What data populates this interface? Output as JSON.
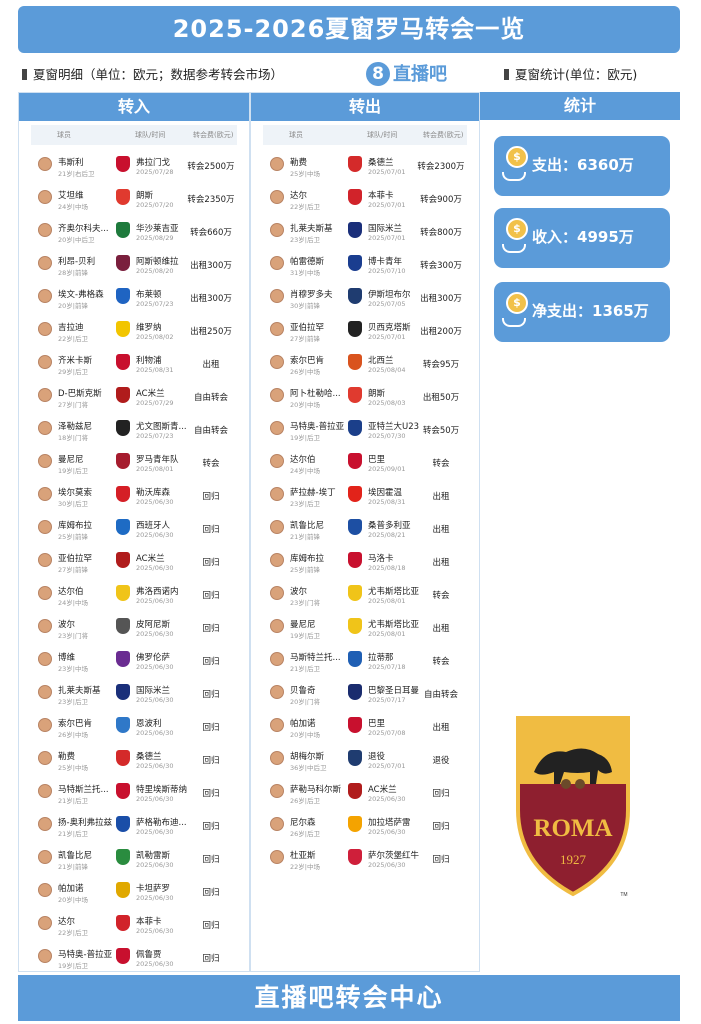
{
  "title": "2025-2026夏窗罗马转会一览",
  "subheads": {
    "left": "夏窗明细（单位：欧元；数据参考转会市场）",
    "logo_badge": "8",
    "logo_text": "直播吧",
    "right": "夏窗统计(单位：欧元)"
  },
  "col_headers": {
    "player": "球员",
    "club": "球队/时间",
    "fee": "转会费(欧元)"
  },
  "panels": {
    "in_title": "转入",
    "out_title": "转出",
    "stats_title": "统计"
  },
  "transfers_in": [
    {
      "name": "韦斯利",
      "info": "21岁|右后卫",
      "club": "弗拉门戈",
      "date": "2025/07/28",
      "fee": "转会2500万",
      "color": "#c8102e"
    },
    {
      "name": "艾坦维",
      "info": "24岁|中场",
      "club": "朗斯",
      "date": "2025/07/20",
      "fee": "转会2350万",
      "color": "#e03a2f"
    },
    {
      "name": "齐奥尔科夫...",
      "info": "20岁|中后卫",
      "club": "华沙莱吉亚",
      "date": "2025/08/29",
      "fee": "转会660万",
      "color": "#1e7a3c"
    },
    {
      "name": "利昂-贝利",
      "info": "28岁|前锋",
      "club": "阿斯顿维拉",
      "date": "2025/08/20",
      "fee": "出租300万",
      "color": "#7a1f3d"
    },
    {
      "name": "埃文-弗格森",
      "info": "20岁|前锋",
      "club": "布莱顿",
      "date": "2025/07/23",
      "fee": "出租300万",
      "color": "#1f64c2"
    },
    {
      "name": "吉拉迪",
      "info": "22岁|后卫",
      "club": "维罗纳",
      "date": "2025/08/02",
      "fee": "出租250万",
      "color": "#f2c500"
    },
    {
      "name": "齐米卡斯",
      "info": "29岁|后卫",
      "club": "利物浦",
      "date": "2025/08/31",
      "fee": "出租",
      "color": "#c8102e"
    },
    {
      "name": "D-巴斯克斯",
      "info": "27岁|门将",
      "club": "AC米兰",
      "date": "2025/07/29",
      "fee": "自由转会",
      "color": "#b01c1c"
    },
    {
      "name": "泽勒兹尼",
      "info": "18岁|门将",
      "club": "尤文图斯青...",
      "date": "2025/07/23",
      "fee": "自由转会",
      "color": "#222222"
    },
    {
      "name": "曼尼尼",
      "info": "19岁|后卫",
      "club": "罗马青年队",
      "date": "2025/08/01",
      "fee": "转会",
      "color": "#a61c2e"
    },
    {
      "name": "埃尔莫索",
      "info": "30岁|后卫",
      "club": "勒沃库森",
      "date": "2025/06/30",
      "fee": "回归",
      "color": "#d51f26"
    },
    {
      "name": "库姆布拉",
      "info": "25岁|前锋",
      "club": "西班牙人",
      "date": "2025/06/30",
      "fee": "回归",
      "color": "#1e6bc4"
    },
    {
      "name": "亚伯拉罕",
      "info": "27岁|前锋",
      "club": "AC米兰",
      "date": "2025/06/30",
      "fee": "回归",
      "color": "#b01c1c"
    },
    {
      "name": "达尔伯",
      "info": "24岁|中场",
      "club": "弗洛西诺内",
      "date": "2025/06/30",
      "fee": "回归",
      "color": "#f0c419"
    },
    {
      "name": "波尔",
      "info": "23岁|门将",
      "club": "皮阿尼斯",
      "date": "2025/06/30",
      "fee": "回归",
      "color": "#555555"
    },
    {
      "name": "博维",
      "info": "23岁|中场",
      "club": "佛罗伦萨",
      "date": "2025/06/30",
      "fee": "回归",
      "color": "#6a2c91"
    },
    {
      "name": "扎莱夫斯基",
      "info": "23岁|后卫",
      "club": "国际米兰",
      "date": "2025/06/30",
      "fee": "回归",
      "color": "#1a2f7a"
    },
    {
      "name": "索尔巴肯",
      "info": "26岁|中场",
      "club": "恩波利",
      "date": "2025/06/30",
      "fee": "回归",
      "color": "#2f78c8"
    },
    {
      "name": "勒费",
      "info": "25岁|中场",
      "club": "桑德兰",
      "date": "2025/06/30",
      "fee": "回归",
      "color": "#d42a2a"
    },
    {
      "name": "马特斯兰托...",
      "info": "21岁|后卫",
      "club": "特里埃斯蒂纳",
      "date": "2025/06/30",
      "fee": "回归",
      "color": "#c8102e"
    },
    {
      "name": "扬-奥利弗拉兹",
      "info": "21岁|后卫",
      "club": "萨格勒布迪...",
      "date": "2025/06/30",
      "fee": "回归",
      "color": "#1a4ea8"
    },
    {
      "name": "凯鲁比尼",
      "info": "21岁|前锋",
      "club": "凯勒雷斯",
      "date": "2025/06/30",
      "fee": "回归",
      "color": "#2a8c3f"
    },
    {
      "name": "帕加诺",
      "info": "20岁|中场",
      "club": "卡坦萨罗",
      "date": "2025/06/30",
      "fee": "回归",
      "color": "#e0a800"
    },
    {
      "name": "达尔",
      "info": "22岁|后卫",
      "club": "本菲卡",
      "date": "2025/06/30",
      "fee": "回归",
      "color": "#d1232a"
    },
    {
      "name": "马特奥-普拉亚",
      "info": "19岁|后卫",
      "club": "佩鲁贾",
      "date": "2025/06/30",
      "fee": "回归",
      "color": "#c8102e"
    }
  ],
  "transfers_out": [
    {
      "name": "勒费",
      "info": "25岁|中场",
      "club": "桑德兰",
      "date": "2025/07/01",
      "fee": "转会2300万",
      "color": "#d42a2a"
    },
    {
      "name": "达尔",
      "info": "22岁|后卫",
      "club": "本菲卡",
      "date": "2025/07/01",
      "fee": "转会900万",
      "color": "#d1232a"
    },
    {
      "name": "扎莱夫斯基",
      "info": "23岁|后卫",
      "club": "国际米兰",
      "date": "2025/07/01",
      "fee": "转会800万",
      "color": "#1a2f7a"
    },
    {
      "name": "帕雷德斯",
      "info": "31岁|中场",
      "club": "博卡青年",
      "date": "2025/07/10",
      "fee": "转会300万",
      "color": "#1a3d8f"
    },
    {
      "name": "肖穆罗多夫",
      "info": "30岁|前锋",
      "club": "伊斯坦布尔",
      "date": "2025/07/05",
      "fee": "出租300万",
      "color": "#1f3c70"
    },
    {
      "name": "亚伯拉罕",
      "info": "27岁|前锋",
      "club": "贝西克塔斯",
      "date": "2025/07/01",
      "fee": "出租200万",
      "color": "#222222"
    },
    {
      "name": "索尔巴肯",
      "info": "26岁|中场",
      "club": "北西兰",
      "date": "2025/08/04",
      "fee": "转会95万",
      "color": "#d9531e"
    },
    {
      "name": "阿卜杜勒哈...",
      "info": "20岁|中场",
      "club": "朗斯",
      "date": "2025/08/03",
      "fee": "出租50万",
      "color": "#e03a2f"
    },
    {
      "name": "马特奥-普拉亚",
      "info": "19岁|后卫",
      "club": "亚特兰大U23",
      "date": "2025/07/30",
      "fee": "转会50万",
      "color": "#1b3f8a"
    },
    {
      "name": "达尔伯",
      "info": "24岁|中场",
      "club": "巴里",
      "date": "2025/09/01",
      "fee": "转会",
      "color": "#c8102e"
    },
    {
      "name": "萨拉赫-埃丁",
      "info": "23岁|后卫",
      "club": "埃因霍温",
      "date": "2025/08/31",
      "fee": "出租",
      "color": "#e2231a"
    },
    {
      "name": "凯鲁比尼",
      "info": "21岁|前锋",
      "club": "桑普多利亚",
      "date": "2025/08/21",
      "fee": "出租",
      "color": "#1d4fa3"
    },
    {
      "name": "库姆布拉",
      "info": "25岁|前锋",
      "club": "马洛卡",
      "date": "2025/08/18",
      "fee": "出租",
      "color": "#c8102e"
    },
    {
      "name": "波尔",
      "info": "23岁|门将",
      "club": "尤韦斯塔比亚",
      "date": "2025/08/01",
      "fee": "转会",
      "color": "#f0c419"
    },
    {
      "name": "曼尼尼",
      "info": "19岁|后卫",
      "club": "尤韦斯塔比亚",
      "date": "2025/08/01",
      "fee": "出租",
      "color": "#f0c419"
    },
    {
      "name": "马斯特兰托...",
      "info": "21岁|后卫",
      "club": "拉蒂那",
      "date": "2025/07/18",
      "fee": "转会",
      "color": "#1f5fb4"
    },
    {
      "name": "贝鲁奇",
      "info": "20岁|门将",
      "club": "巴黎圣日耳曼",
      "date": "2025/07/17",
      "fee": "自由转会",
      "color": "#1a2c6e"
    },
    {
      "name": "帕加诺",
      "info": "20岁|中场",
      "club": "巴里",
      "date": "2025/07/08",
      "fee": "出租",
      "color": "#c8102e"
    },
    {
      "name": "胡梅尔斯",
      "info": "36岁|中后卫",
      "club": "退役",
      "date": "2025/07/01",
      "fee": "退役",
      "color": "#1f3c70"
    },
    {
      "name": "萨勒马科尔斯",
      "info": "26岁|后卫",
      "club": "AC米兰",
      "date": "2025/06/30",
      "fee": "回归",
      "color": "#b01c1c"
    },
    {
      "name": "尼尔森",
      "info": "26岁|后卫",
      "club": "加拉塔萨雷",
      "date": "2025/06/30",
      "fee": "回归",
      "color": "#f4a300"
    },
    {
      "name": "杜亚斯",
      "info": "22岁|中场",
      "club": "萨尔茨堡红牛",
      "date": "2025/06/30",
      "fee": "回归",
      "color": "#cf1f3a"
    }
  ],
  "stats": [
    {
      "label": "支出：",
      "value": "6360万"
    },
    {
      "label": "收入：",
      "value": "4995万"
    },
    {
      "label": "净支出：",
      "value": "1365万"
    }
  ],
  "roma_badge": {
    "text": "ROMA",
    "year": "1927",
    "tm": "TM",
    "colors": {
      "maroon": "#8e1f2f",
      "gold": "#f0bc42"
    }
  },
  "footer": "直播吧转会中心",
  "colors": {
    "accent": "#5b9bd9"
  }
}
